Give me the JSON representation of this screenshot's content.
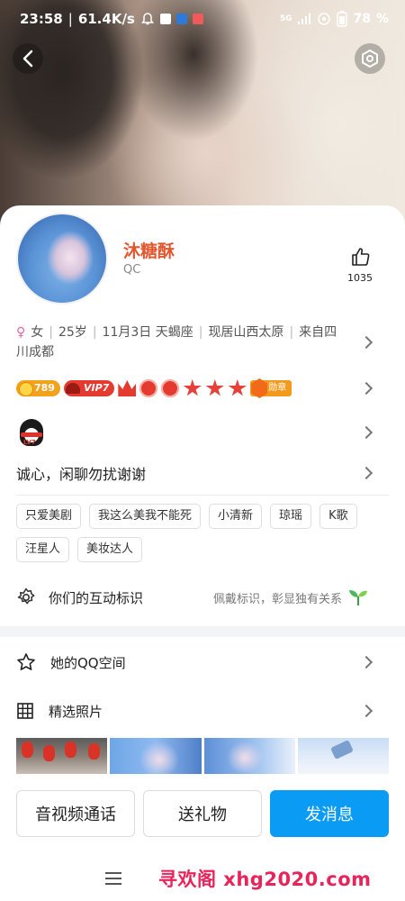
{
  "status_bar": {
    "time": "23:58",
    "network_speed": "61.4K/s",
    "signal": "5G",
    "battery": "78",
    "battery_unit": "%"
  },
  "profile": {
    "nickname": "沐糖酥",
    "qq_label": "QC",
    "like_count": "1035",
    "gender": "女",
    "age": "25岁",
    "birthday": "11月3日",
    "zodiac": "天蝎座",
    "residence": "现居山西太原",
    "hometown_line1": "来自四",
    "hometown_line2": "川成都",
    "signature": "诚心，闲聊勿扰谢谢"
  },
  "badges": {
    "coin_value": "789",
    "vip_label": "VIP7",
    "medal_label": "勋章"
  },
  "tags": [
    "只爱美剧",
    "我这么美我不能死",
    "小清新",
    "琼瑶",
    "K歌",
    "汪星人",
    "美妆达人"
  ],
  "interaction": {
    "label": "你们的互动标识",
    "hint": "佩戴标识，彰显独有关系"
  },
  "lists": {
    "qzone_label": "她的QQ空间",
    "photos_label": "精选照片"
  },
  "actions": {
    "call_label": "音视频通话",
    "gift_label": "送礼物",
    "message_label": "发消息"
  },
  "watermark": "寻欢阁 xhg2020.com",
  "colors": {
    "nickname": "#e4572e",
    "primary_button": "#0a9cf5",
    "watermark": "#e8245a"
  }
}
